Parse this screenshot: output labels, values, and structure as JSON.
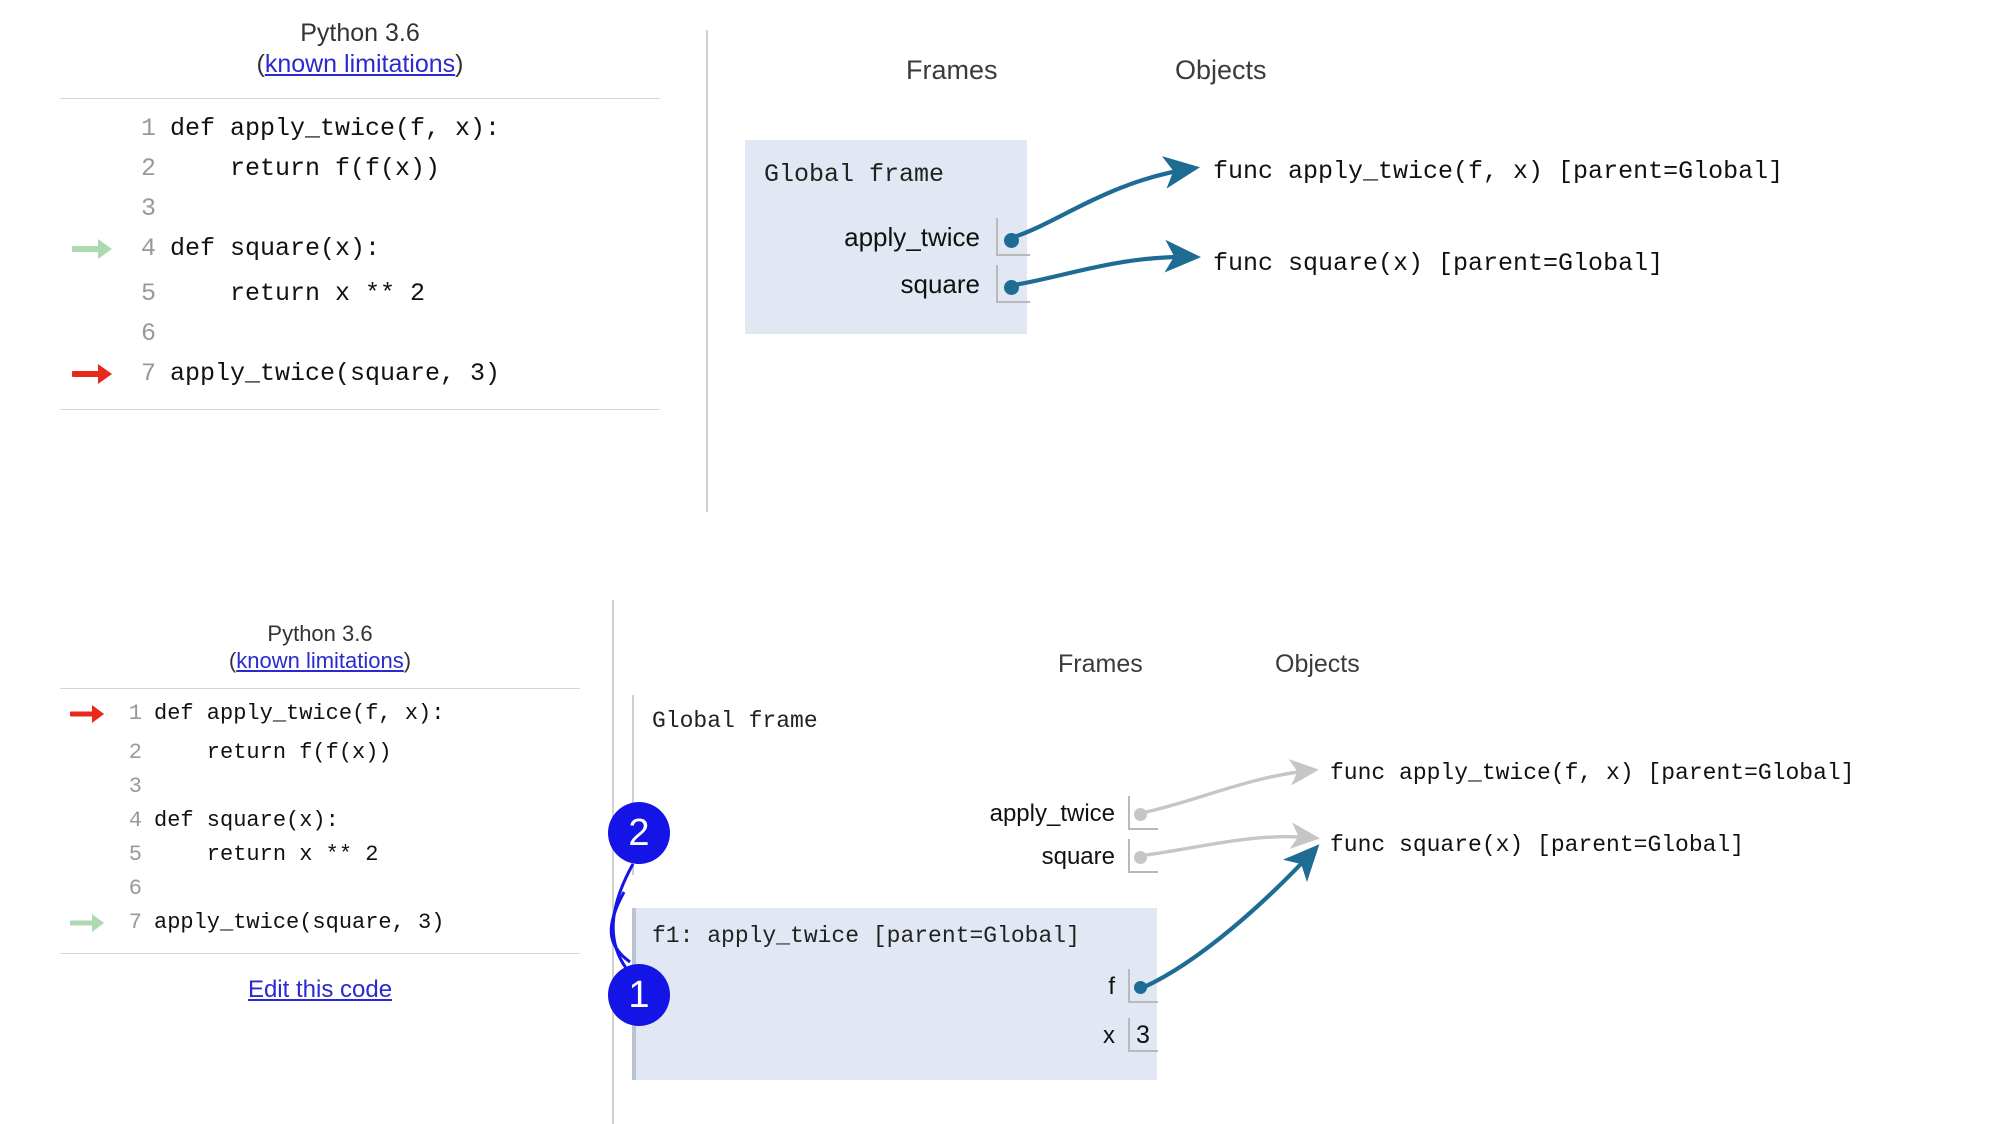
{
  "panels": [
    {
      "id": "top",
      "editor": {
        "python_version": "Python 3.6",
        "limitations_open_paren": "(",
        "limitations_link": "known limitations",
        "limitations_close_paren": ")",
        "lines": [
          {
            "n": "1",
            "text": "def apply_twice(f, x):",
            "marker": "none"
          },
          {
            "n": "2",
            "text": "    return f(f(x))",
            "marker": "none"
          },
          {
            "n": "3",
            "text": "",
            "marker": "none"
          },
          {
            "n": "4",
            "text": "def square(x):",
            "marker": "green"
          },
          {
            "n": "5",
            "text": "    return x ** 2",
            "marker": "none"
          },
          {
            "n": "6",
            "text": "",
            "marker": "none"
          },
          {
            "n": "7",
            "text": "apply_twice(square, 3)",
            "marker": "red"
          }
        ],
        "edit_link": null
      },
      "viz": {
        "frames_header": "Frames",
        "objects_header": "Objects",
        "frames": [
          {
            "title": "Global frame",
            "highlighted": true,
            "vars": [
              {
                "name": "apply_twice",
                "value": "pointer"
              },
              {
                "name": "square",
                "value": "pointer"
              }
            ]
          }
        ],
        "objects": [
          "func apply_twice(f, x) [parent=Global]",
          "func square(x) [parent=Global]"
        ]
      }
    },
    {
      "id": "bottom",
      "editor": {
        "python_version": "Python 3.6",
        "limitations_open_paren": "(",
        "limitations_link": "known limitations",
        "limitations_close_paren": ")",
        "lines": [
          {
            "n": "1",
            "text": "def apply_twice(f, x):",
            "marker": "red"
          },
          {
            "n": "2",
            "text": "    return f(f(x))",
            "marker": "none"
          },
          {
            "n": "3",
            "text": "",
            "marker": "none"
          },
          {
            "n": "4",
            "text": "def square(x):",
            "marker": "none"
          },
          {
            "n": "5",
            "text": "    return x ** 2",
            "marker": "none"
          },
          {
            "n": "6",
            "text": "",
            "marker": "none"
          },
          {
            "n": "7",
            "text": "apply_twice(square, 3)",
            "marker": "green"
          }
        ],
        "edit_link": "Edit this code"
      },
      "viz": {
        "frames_header": "Frames",
        "objects_header": "Objects",
        "frames": [
          {
            "title": "Global frame",
            "highlighted": false,
            "vars": [
              {
                "name": "apply_twice",
                "value": "pointer"
              },
              {
                "name": "square",
                "value": "pointer"
              }
            ]
          },
          {
            "title": "f1: apply_twice [parent=Global]",
            "highlighted": true,
            "vars": [
              {
                "name": "f",
                "value": "pointer"
              },
              {
                "name": "x",
                "value": "3"
              }
            ]
          }
        ],
        "objects": [
          "func apply_twice(f, x) [parent=Global]",
          "func square(x) [parent=Global]"
        ],
        "annotations": [
          {
            "label": "1"
          },
          {
            "label": "2"
          }
        ]
      }
    }
  ],
  "colors": {
    "frame_highlight": "#e2e8f3",
    "arrow_active": "#1e6b94",
    "arrow_inactive": "#c6c6c6",
    "marker_current": "#e8291c",
    "marker_next": "#add9b0",
    "link": "#2a2ad0",
    "badge": "#1414e6"
  }
}
